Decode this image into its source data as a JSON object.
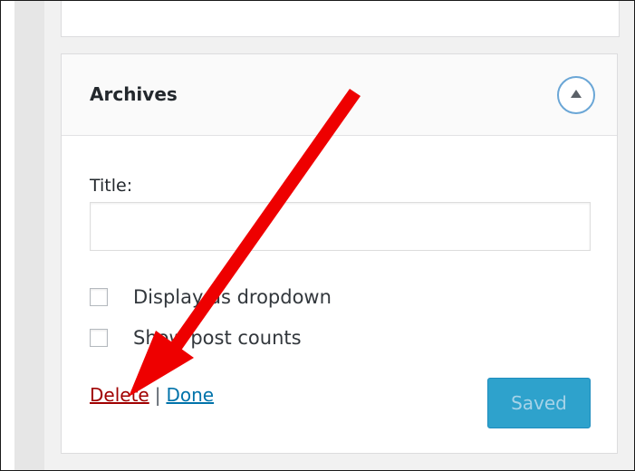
{
  "widget": {
    "title": "Archives",
    "toggle_icon": "arrow-up-icon",
    "field_label": "Title:",
    "title_value": "",
    "checkboxes": [
      {
        "label": "Display as dropdown",
        "checked": false
      },
      {
        "label": "Show post counts",
        "checked": false
      }
    ],
    "delete_label": "Delete",
    "separator": "|",
    "done_label": "Done",
    "save_label": "Saved"
  },
  "colors": {
    "delete_link": "#a00000",
    "done_link": "#0073aa",
    "save_button": "#2ea2cc",
    "annotation_arrow": "#ff0000"
  }
}
